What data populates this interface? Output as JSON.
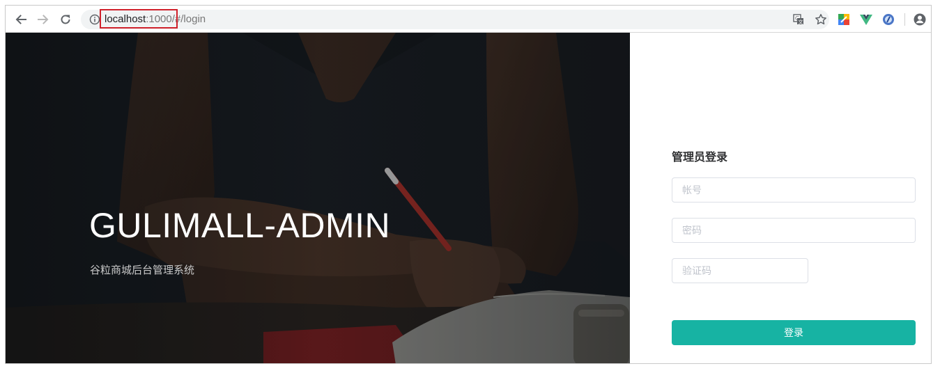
{
  "browser": {
    "url": {
      "host": "localhost",
      "port": ":1000",
      "path": "/#/login"
    },
    "icons": {
      "back": "arrow-left-icon",
      "forward": "arrow-right-icon",
      "reload": "reload-icon",
      "site_info": "info-icon",
      "translate": "translate-icon",
      "bookmark": "star-icon",
      "extensions": [
        "colorful-extension-icon",
        "vue-devtools-icon",
        "blue-circle-extension-icon"
      ],
      "profile": "profile-icon"
    },
    "highlight_color": "#d0212b"
  },
  "hero": {
    "title": "GULIMALL-ADMIN",
    "subtitle": "谷粒商城后台管理系统"
  },
  "login": {
    "title": "管理员登录",
    "username_placeholder": "帐号",
    "password_placeholder": "密码",
    "captcha_placeholder": "验证码",
    "submit_label": "登录",
    "accent_color": "#17b3a3"
  }
}
